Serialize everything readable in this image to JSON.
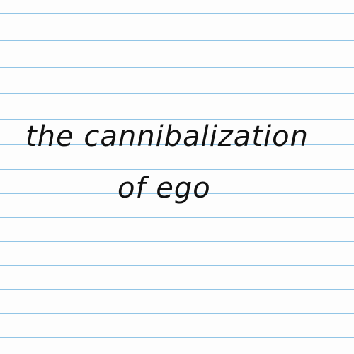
{
  "note": {
    "line1": "the cannibalization",
    "line2": "of ego"
  },
  "colors": {
    "ink": "#111111",
    "rule": "#86bfe3",
    "paper": "#fdfdfd"
  }
}
